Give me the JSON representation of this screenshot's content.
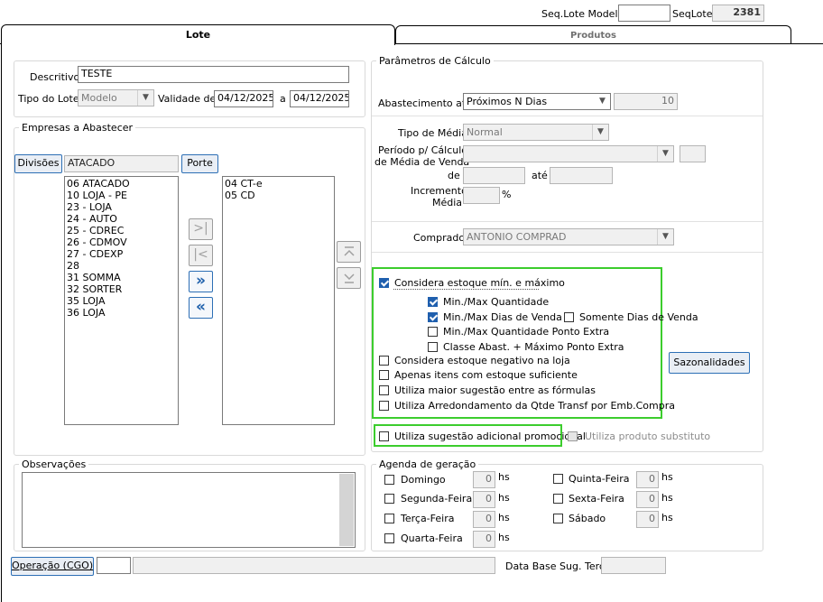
{
  "header": {
    "seq_lote_modelo_label": "Seq.Lote Modelo",
    "seq_lote_modelo_value": "",
    "seq_lote_label": "SeqLote",
    "seq_lote_value": "2381"
  },
  "tabs": [
    {
      "label": "Lote",
      "active": true
    },
    {
      "label": "Produtos",
      "active": false
    }
  ],
  "lote": {
    "descritivo_label": "Descritivo",
    "descritivo_value": "TESTE",
    "tipo_lote_label": "Tipo do Lote",
    "tipo_lote_value": "Modelo",
    "validade_label": "Validade de",
    "validade_de": "04/12/2025",
    "validade_a_label": "a",
    "validade_ate": "04/12/2025"
  },
  "empresas": {
    "title": "Empresas a Abastecer",
    "divisoes_button": "Divisões",
    "divisao_value": "ATACADO",
    "porte_button": "Porte",
    "available": [
      "06 ATACADO",
      "10 LOJA - PE",
      "23 - LOJA",
      "24 - AUTO",
      "25 - CDREC",
      "26 - CDMOV",
      "27 - CDEXP",
      "28",
      "31 SOMMA",
      "32 SORTER",
      "35 LOJA",
      "36 LOJA"
    ],
    "selected": [
      "04 CT-e",
      "05 CD"
    ],
    "move_last_icon": ">|",
    "move_first_icon": "|<",
    "add_all_icon": "»",
    "remove_all_icon": "«",
    "up_icon": "up-arrow",
    "down_icon": "down-arrow"
  },
  "observacoes": {
    "title": "Observações",
    "value": ""
  },
  "parametros": {
    "title": "Parâmetros de Cálculo",
    "abastecimento_label": "Abastecimento até",
    "abastecimento_value": "Próximos N Dias",
    "abastecimento_dias": "10",
    "tipo_media_label": "Tipo de Média",
    "tipo_media_value": "Normal",
    "periodo_label_1": "Período p/ Cálculo",
    "periodo_label_2": "de Média de Venda",
    "periodo_value": "",
    "periodo_extra": "",
    "de_label": "de",
    "de_value": "",
    "ate_label": "até",
    "ate_value": "",
    "incremento_label_1": "Incremento",
    "incremento_label_2": "Média",
    "incremento_value": "",
    "percent": "%",
    "comprador_label": "Comprador",
    "comprador_value": "ANTONIO COMPRAD"
  },
  "estoque_options": {
    "considera_min_max": {
      "label": "Considera estoque mín. e máximo",
      "checked": true
    },
    "min_max_quantidade": {
      "label": "Min./Max Quantidade",
      "checked": true
    },
    "min_max_dias_venda": {
      "label": "Min./Max Dias de Venda",
      "checked": true
    },
    "somente_dias_venda": {
      "label": "Somente Dias de Venda",
      "checked": false
    },
    "min_max_qtd_ponto_extra": {
      "label": "Min./Max Quantidade Ponto Extra",
      "checked": false
    },
    "classe_abast_ponto_extra": {
      "label": "Classe Abast. + Máximo Ponto Extra",
      "checked": false
    },
    "considera_negativo": {
      "label": "Considera estoque negativo na loja",
      "checked": false
    },
    "apenas_suficiente": {
      "label": "Apenas itens com estoque suficiente",
      "checked": false
    },
    "maior_sugestao": {
      "label": "Utiliza maior sugestão entre as fórmulas",
      "checked": false
    },
    "arredondamento": {
      "label": "Utiliza Arredondamento da Qtde Transf por Emb.Compra",
      "checked": false
    },
    "sazonalidades_button": "Sazonalidades",
    "sugestao_promocional": {
      "label": "Utiliza sugestão adicional promocional",
      "checked": false
    },
    "produto_substituto": {
      "label": "Utiliza produto substituto",
      "checked": false
    }
  },
  "agenda": {
    "title": "Agenda de geração",
    "hs": "hs",
    "days_left": [
      {
        "label": "Domingo",
        "hours": "0"
      },
      {
        "label": "Segunda-Feira",
        "hours": "0"
      },
      {
        "label": "Terça-Feira",
        "hours": "0"
      },
      {
        "label": "Quarta-Feira",
        "hours": "0"
      }
    ],
    "days_right": [
      {
        "label": "Quinta-Feira",
        "hours": "0"
      },
      {
        "label": "Sexta-Feira",
        "hours": "0"
      },
      {
        "label": "Sábado",
        "hours": "0"
      }
    ]
  },
  "footer": {
    "operacao_button": "Operação (CGO)",
    "operacao_code": "",
    "operacao_desc": "",
    "data_base_label": "Data Base Sug. Terc.",
    "data_base_value": ""
  }
}
